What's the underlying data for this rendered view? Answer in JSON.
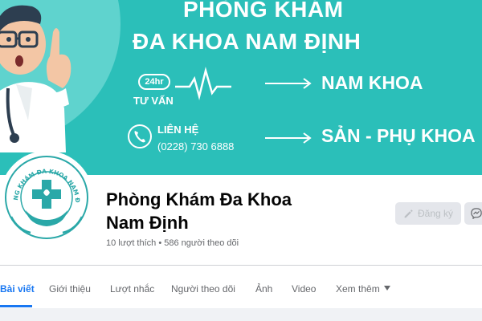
{
  "cover": {
    "title_line1": "PHÒNG KHÁM",
    "title_line2": "ĐA KHOA  NAM ĐỊNH",
    "badge_24": "24hr",
    "consult_label": "TƯ VẤN",
    "service_1": "NAM KHOA",
    "contact_label": "LIÊN HỆ",
    "contact_phone": "(0228) 730 6888",
    "service_2": "SẢN - PHỤ KHOA",
    "colors": {
      "background": "#2bbfb9",
      "circle": "#5fd3ce",
      "text": "#ffffff"
    }
  },
  "logo": {
    "ring_text": "PHÒNG KHÁM ĐA KHOA NAM ĐỊNH",
    "color": "#2aa8a8",
    "icon": "medical-cross-hands-logo"
  },
  "page": {
    "name_line1": "Phòng Khám Đa Khoa",
    "name_line2": "Nam Định",
    "stats": "10 lượt thích • 586 người theo dõi"
  },
  "actions": {
    "follow_label": "Đăng ký",
    "follow_icon": "pencil-icon",
    "message_icon": "messenger-icon"
  },
  "tabs": [
    {
      "label": "Bài viết",
      "active": true
    },
    {
      "label": "Giới thiệu",
      "active": false
    },
    {
      "label": "Lượt nhắc",
      "active": false
    },
    {
      "label": "Người theo dõi",
      "active": false
    },
    {
      "label": "Ảnh",
      "active": false
    },
    {
      "label": "Video",
      "active": false
    },
    {
      "label": "Xem thêm",
      "active": false
    }
  ],
  "theme": {
    "accent": "#1877f2",
    "muted_text": "#65676b",
    "divider": "#ced0d4"
  }
}
